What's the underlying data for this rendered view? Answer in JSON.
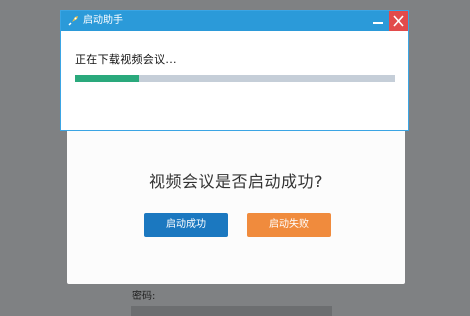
{
  "background": {
    "password_label": "密码:"
  },
  "confirm_dialog": {
    "question": "视频会议是否启动成功?",
    "success_button": "启动成功",
    "failed_button": "启动失败"
  },
  "helper_window": {
    "title": "启动助手",
    "status": "正在下载视频会议...",
    "progress": 0.2,
    "colors": {
      "titlebar": "#2b9ad9",
      "close": "#e24b4b",
      "progress_fill": "#2aa97c",
      "progress_track": "#c5ced8"
    }
  }
}
